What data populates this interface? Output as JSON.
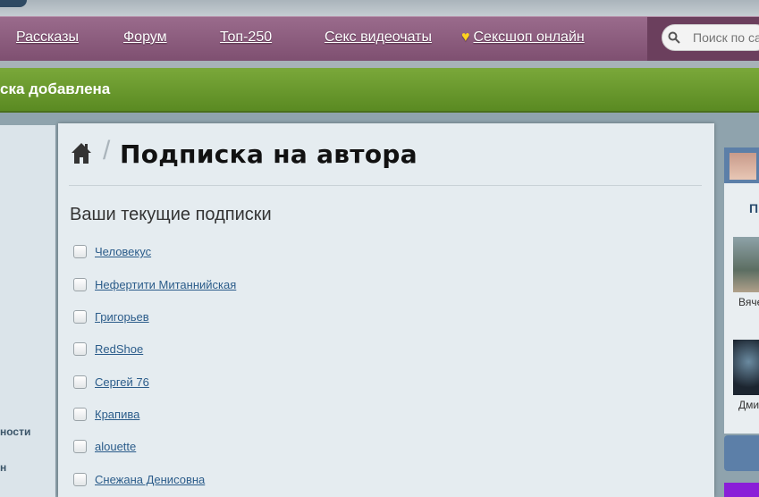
{
  "nav": {
    "items": [
      "Рассказы",
      "Форум",
      "Топ-250",
      "Секс видеочаты",
      "Сексшоп онлайн"
    ],
    "search_placeholder": "Поиск по са"
  },
  "notice": {
    "text": "ска добавлена"
  },
  "left_sidebar": {
    "links": [
      "ности",
      "н"
    ]
  },
  "page": {
    "title": "Подписка на автора",
    "section_title": "Ваши текущие подписки",
    "subscriptions": [
      "Человекус",
      "Нефертити Митаннийская",
      "Григорьев",
      "RedShoe",
      "Сергей 76",
      "Крапива",
      "alouette",
      "Снежана Денисовна"
    ]
  },
  "right_sidebar": {
    "heading_letter": "П",
    "names": [
      "Вяче",
      "Дми"
    ]
  },
  "colors": {
    "nav_bg": "#8a5c7c",
    "notice_bg": "#6a9a2e",
    "link": "#2b5c8a"
  }
}
